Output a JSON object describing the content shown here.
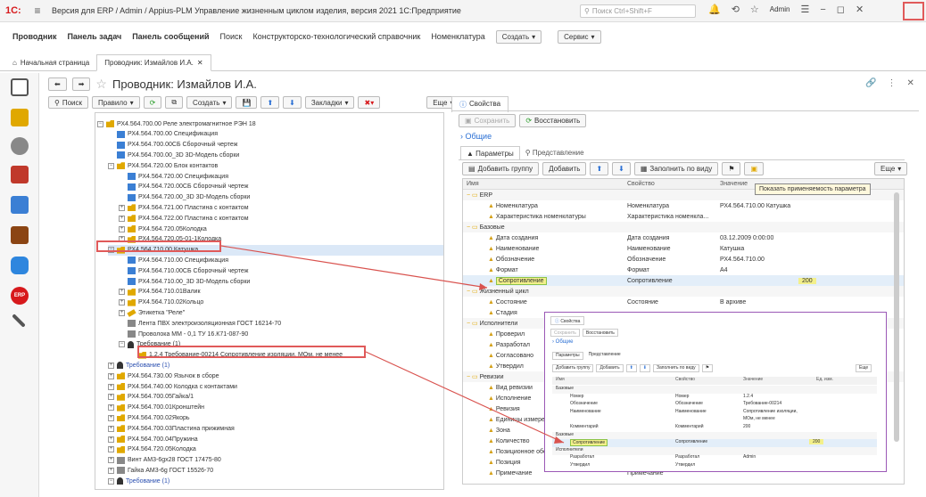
{
  "window": {
    "logo": "1С:",
    "title": "Версия для ERP / Admin / Appius-PLM Управление жизненным циклом изделия, версия 2021 1С:Предприятие",
    "search_placeholder": "Поиск Ctrl+Shift+F",
    "user": "Admin"
  },
  "nav": {
    "items": [
      "Проводник",
      "Панель задач",
      "Панель сообщений",
      "Поиск",
      "Конструкторско-технологический справочник",
      "Номенклатура"
    ],
    "create": "Создать",
    "service": "Сервис"
  },
  "tabs": [
    {
      "label": "Начальная страница"
    },
    {
      "label": "Проводник: Измайлов И.А."
    }
  ],
  "page": {
    "title": "Проводник: Измайлов И.А."
  },
  "toolbar": {
    "search": "Поиск",
    "rule": "Правило",
    "create": "Создать",
    "bookmarks": "Закладки",
    "more": "Еще"
  },
  "tree": [
    {
      "t": "РХ4.564.700.00 Реле электромагнитное РЭН 18",
      "l": 0,
      "i": "fold",
      "e": "−"
    },
    {
      "t": "РХ4.564.700.00 Спецификация",
      "l": 1,
      "i": "doc"
    },
    {
      "t": "РХ4.564.700.00СБ Сборочный чертеж",
      "l": 1,
      "i": "doc"
    },
    {
      "t": "РХ4.564.700.00_3D 3D-Модель сборки",
      "l": 1,
      "i": "doc"
    },
    {
      "t": "РХ4.564.720.00 Блок контактов",
      "l": 1,
      "i": "fold",
      "e": "−"
    },
    {
      "t": "РХ4.564.720.00 Спецификация",
      "l": 2,
      "i": "doc"
    },
    {
      "t": "РХ4.564.720.00СБ Сборочный чертеж",
      "l": 2,
      "i": "doc"
    },
    {
      "t": "РХ4.564.720.00_3D 3D-Модель сборки",
      "l": 2,
      "i": "doc"
    },
    {
      "t": "РХ4.564.721.00 Пластина с контактом",
      "l": 2,
      "i": "fold",
      "e": "+"
    },
    {
      "t": "РХ4.564.722.00 Пластина с контактом",
      "l": 2,
      "i": "fold",
      "e": "+"
    },
    {
      "t": "РХ4.564.720.05Колодка",
      "l": 2,
      "i": "fold",
      "e": "+"
    },
    {
      "t": "РХ4.564.720.05-01-1Колодка",
      "l": 2,
      "i": "fold",
      "e": "+"
    },
    {
      "t": "РХ4.564.710.00 Катушка",
      "l": 1,
      "i": "fold",
      "e": "−",
      "sel": true
    },
    {
      "t": "РХ4.564.710.00 Спецификация",
      "l": 2,
      "i": "doc"
    },
    {
      "t": "РХ4.564.710.00СБ Сборочный чертеж",
      "l": 2,
      "i": "doc"
    },
    {
      "t": "РХ4.564.710.00_3D 3D-Модель сборки",
      "l": 2,
      "i": "doc"
    },
    {
      "t": "РХ4.564.710.01Валик",
      "l": 2,
      "i": "fold",
      "e": "+"
    },
    {
      "t": "РХ4.564.710.02Кольцо",
      "l": 2,
      "i": "fold",
      "e": "+"
    },
    {
      "t": "Этикетка \"Реле\"",
      "l": 2,
      "i": "tag",
      "e": "+"
    },
    {
      "t": "Лента ПВХ электроизоляционная ГОСТ 16214-70",
      "l": 2,
      "i": "gray"
    },
    {
      "t": "Проволока ММ - 0,1 ТУ 16.К71-087-90",
      "l": 2,
      "i": "gray"
    },
    {
      "t": "Требование (1)",
      "l": 2,
      "i": "bell",
      "e": "−"
    },
    {
      "t": "1.2.4 Требование-00214 Сопротивление изоляции, МОм, не менее",
      "l": 3,
      "i": "fold",
      "box": true
    },
    {
      "t": "Требование (1)",
      "l": 1,
      "i": "bell",
      "e": "+",
      "link": true
    },
    {
      "t": "РХ4.564.730.00 Язычок в сборе",
      "l": 1,
      "i": "fold",
      "e": "+"
    },
    {
      "t": "РХ4.564.740.00 Колодка с контактами",
      "l": 1,
      "i": "fold",
      "e": "+"
    },
    {
      "t": "РХ4.564.700.05Гайка/1",
      "l": 1,
      "i": "fold",
      "e": "+"
    },
    {
      "t": "РХ4.564.700.01Кронштейн",
      "l": 1,
      "i": "fold",
      "e": "+"
    },
    {
      "t": "РХ4.564.700.02Якорь",
      "l": 1,
      "i": "fold",
      "e": "+"
    },
    {
      "t": "РХ4.564.700.03Пластина прижимная",
      "l": 1,
      "i": "fold",
      "e": "+"
    },
    {
      "t": "РХ4.564.700.04Пружина",
      "l": 1,
      "i": "fold",
      "e": "+"
    },
    {
      "t": "РХ4.564.720.05Колодка",
      "l": 1,
      "i": "fold",
      "e": "+"
    },
    {
      "t": "Винт АМ3-6gx28 ГОСТ 17475-80",
      "l": 1,
      "i": "gray",
      "e": "+"
    },
    {
      "t": "Гайка АМ3-6g ГОСТ 15526-70",
      "l": 1,
      "i": "gray",
      "e": "+"
    },
    {
      "t": "Требование (1)",
      "l": 1,
      "i": "bell",
      "e": "−",
      "link": true
    }
  ],
  "props": {
    "tab": "Свойства",
    "save": "Сохранить",
    "restore": "Восстановить",
    "common": "Общие",
    "tab_params": "Параметры",
    "tab_view": "Представление",
    "add_group": "Добавить группу",
    "add": "Добавить",
    "fill": "Заполнить по виду",
    "more": "Еще",
    "tooltip": "Показать применяемость параметра",
    "headers": [
      "Имя",
      "Свойство",
      "Значение"
    ],
    "rows": [
      {
        "n": "ERP",
        "g": true,
        "e": "−"
      },
      {
        "n": "Номенклатура",
        "p": "Номенклатура",
        "v": "РХ4.564.710.00 Катушка"
      },
      {
        "n": "Характеристика номенклатуры",
        "p": "Характеристика номенкла..."
      },
      {
        "n": "Базовые",
        "g": true,
        "e": "−"
      },
      {
        "n": "Дата создания",
        "p": "Дата создания",
        "v": "03.12.2009 0:00:00"
      },
      {
        "n": "Наименование",
        "p": "Наименование",
        "v": "Катушка"
      },
      {
        "n": "Обозначение",
        "p": "Обозначение",
        "v": "РХ4.564.710.00"
      },
      {
        "n": "Формат",
        "p": "Формат",
        "v": "А4"
      },
      {
        "n": "Сопротивление",
        "p": "Сопротивление",
        "v": "200",
        "hl": true
      },
      {
        "n": "Жизненный цикл",
        "g": true,
        "e": "−"
      },
      {
        "n": "Состояние",
        "p": "Состояние",
        "v": "В архиве"
      },
      {
        "n": "Стадия"
      },
      {
        "n": "Исполнители",
        "g": true,
        "e": "−"
      },
      {
        "n": "Проверил"
      },
      {
        "n": "Разработал"
      },
      {
        "n": "Согласовано"
      },
      {
        "n": "Утвердил"
      },
      {
        "n": "Ревизии",
        "g": true,
        "e": "−"
      },
      {
        "n": "Вид ревизии"
      },
      {
        "n": "Исполнение"
      },
      {
        "n": "Ревизия"
      },
      {
        "n": "Единицы измере"
      },
      {
        "n": "Зона"
      },
      {
        "n": "Количество"
      },
      {
        "n": "Позиционное обозначение"
      },
      {
        "n": "Позиция"
      },
      {
        "n": "Примечание",
        "p": "Примечание"
      }
    ]
  },
  "inset": {
    "tab": "Свойства",
    "save": "Сохранить",
    "restore": "Восстановить",
    "common": "Общие",
    "tab_params": "Параметры",
    "tab_view": "Представление",
    "add_group": "Добавить группу",
    "add": "Добавить",
    "fill": "Заполнить по виду",
    "more": "Еще",
    "headers": [
      "Имя",
      "Свойство",
      "Значение",
      "Ед. изм."
    ],
    "rows": [
      {
        "n": "Базовые",
        "g": true
      },
      {
        "n": "Номер",
        "p": "Номер",
        "v": "1.2.4"
      },
      {
        "n": "Обозначение",
        "p": "Обозначение",
        "v": "Требование-00214"
      },
      {
        "n": "Наименование",
        "p": "Наименование",
        "v": "Сопротивление изоляции,"
      },
      {
        "n": "",
        "p": "",
        "v": "МОм, не менее"
      },
      {
        "n": "Комментарий",
        "p": "Комментарий",
        "v": "200"
      },
      {
        "n": "Базовые",
        "g": true
      },
      {
        "n": "Сопротивление",
        "p": "Сопротивление",
        "v": "200",
        "hl": true
      },
      {
        "n": "Исполнители",
        "g": true
      },
      {
        "n": "Разработал",
        "p": "Разработал",
        "v": "Admin"
      },
      {
        "n": "Утвердил",
        "p": "Утвердил"
      }
    ]
  }
}
